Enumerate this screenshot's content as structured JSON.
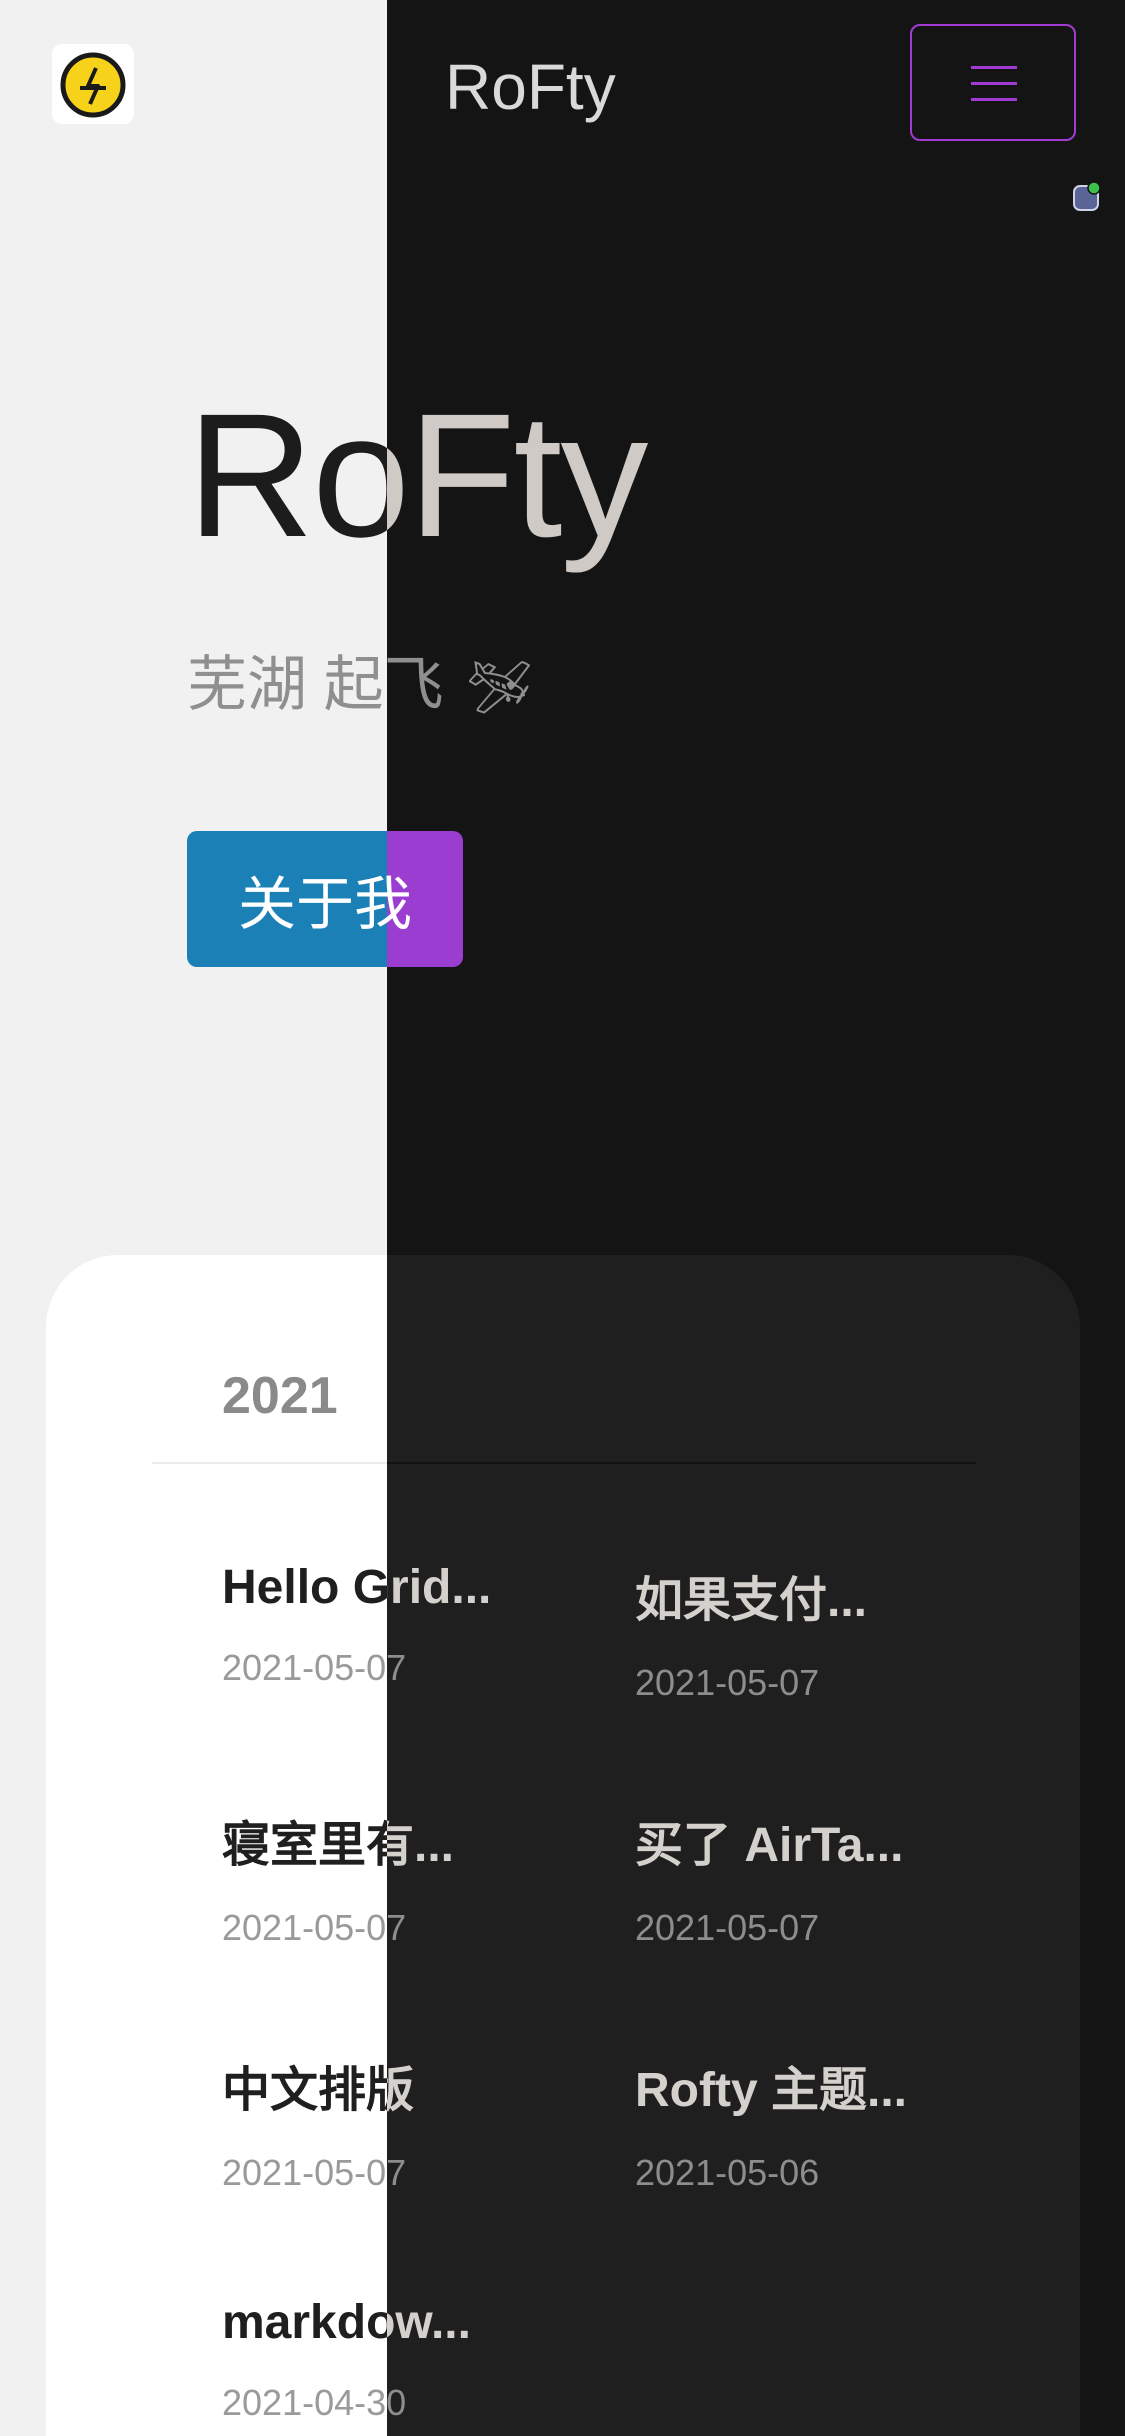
{
  "header": {
    "site_title": "RoFty",
    "logo_name": "lightning-logo",
    "menu_icon": "hamburger-icon"
  },
  "hero": {
    "title": "RoFty",
    "subtitle": "芜湖 起飞",
    "subtitle_emoji": "🛩",
    "about_button": "关于我"
  },
  "archive": {
    "year": "2021",
    "posts": [
      {
        "title": "Hello Grid...",
        "date": "2021-05-07"
      },
      {
        "title": "如果支付...",
        "date": "2021-05-07"
      },
      {
        "title": "寝室里有...",
        "date": "2021-05-07"
      },
      {
        "title": "买了 AirTa...",
        "date": "2021-05-07"
      },
      {
        "title": "中文排版",
        "date": "2021-05-07"
      },
      {
        "title": "Rofty 主题...",
        "date": "2021-05-06"
      },
      {
        "title": "markdow...",
        "date": "2021-04-30"
      }
    ]
  },
  "colors": {
    "light_bg": "#f1f1f1",
    "dark_bg": "#141414",
    "button_blue": "#1b80b6",
    "accent_purple": "#a13bd4",
    "status_green": "#3cc24c"
  }
}
